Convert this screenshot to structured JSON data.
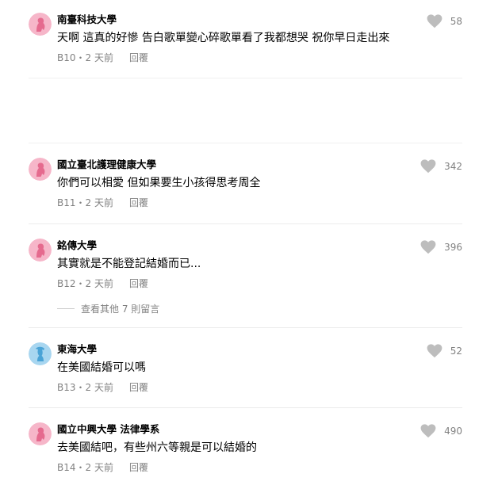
{
  "colors": {
    "female_avatar_bg": "#f6b6c9",
    "female_avatar_fg": "#e56a8e",
    "male_avatar_bg": "#a8d6f0",
    "male_avatar_fg": "#4aa3d6",
    "like_icon": "#bdbdbd"
  },
  "comments": [
    {
      "author": "南臺科技大學",
      "text": "天啊 這真的好慘 告白歌單變心碎歌單看了我都想哭 祝你早日走出來",
      "floor_time": "B10・2 天前",
      "reply": "回覆",
      "likes": "58",
      "avatar": "female-avatar-icon"
    },
    {
      "author": "國立臺北護理健康大學",
      "text": "你們可以相愛  但如果要生小孩得思考周全",
      "floor_time": "B11・2 天前",
      "reply": "回覆",
      "likes": "342",
      "avatar": "female-avatar-icon"
    },
    {
      "author": "銘傳大學",
      "text": "其實就是不能登記結婚而已...",
      "floor_time": "B12・2 天前",
      "reply": "回覆",
      "likes": "396",
      "avatar": "female-avatar-icon"
    },
    {
      "author": "東海大學",
      "text": "在美國結婚可以嗎",
      "floor_time": "B13・2 天前",
      "reply": "回覆",
      "likes": "52",
      "avatar": "male-avatar-icon"
    },
    {
      "author": "國立中興大學 法律學系",
      "text": "去美國結吧，有些州六等親是可以結婚的",
      "floor_time": "B14・2 天前",
      "reply": "回覆",
      "likes": "490",
      "avatar": "female-avatar-icon"
    }
  ],
  "more_replies_label": "查看其他 7 則留言"
}
